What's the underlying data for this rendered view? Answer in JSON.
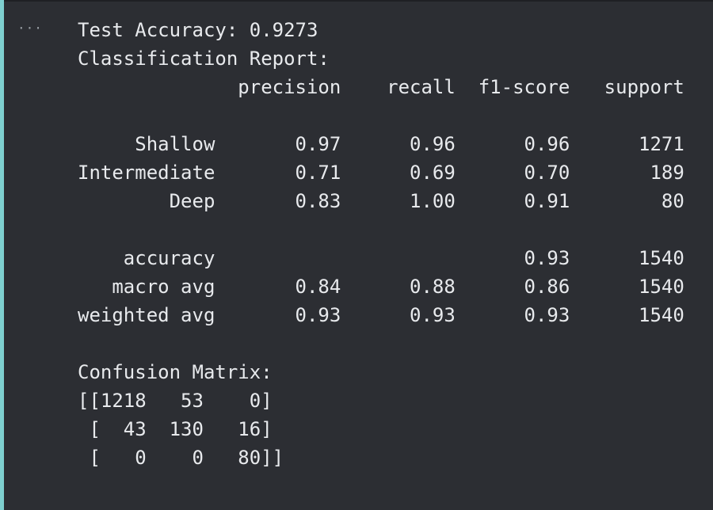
{
  "output_menu": {
    "icon": "ellipsis-icon",
    "label": "···"
  },
  "output": {
    "lines": [
      "Test Accuracy: 0.9273",
      "Classification Report:",
      "              precision    recall  f1-score   support",
      "",
      "     Shallow       0.97      0.96      0.96      1271",
      "Intermediate       0.71      0.69      0.70       189",
      "        Deep       0.83      1.00      0.91        80",
      "",
      "    accuracy                           0.93      1540",
      "   macro avg       0.84      0.88      0.86      1540",
      "weighted avg       0.93      0.93      0.93      1540",
      "",
      "Confusion Matrix:",
      "[[1218   53    0]",
      " [  43  130   16]",
      " [   0    0   80]]"
    ]
  }
}
